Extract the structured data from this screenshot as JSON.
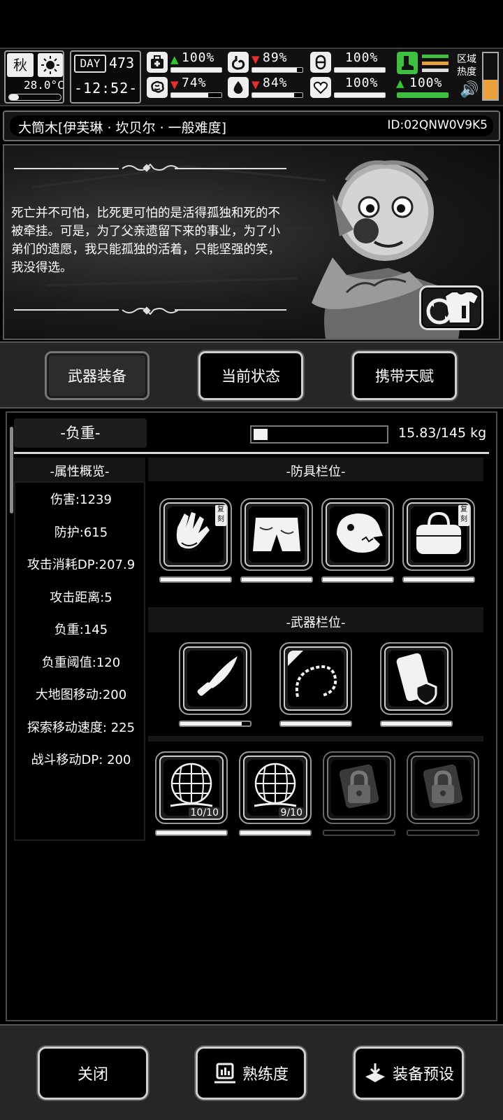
{
  "hud": {
    "season": "秋",
    "weather_icon": "sun-icon",
    "temperature": "28.0°C",
    "day_label": "DAY",
    "day_number": "473",
    "time": "-12:52-",
    "stats": [
      {
        "name": "health",
        "icon": "medkit-icon",
        "trend": "up",
        "value": "100%",
        "fill": 1.0
      },
      {
        "name": "hunger",
        "icon": "stomach-icon",
        "trend": "down",
        "value": "89%",
        "fill": 0.89
      },
      {
        "name": "stamina",
        "icon": "capsule-icon",
        "trend": "",
        "value": "100%",
        "fill": 1.0
      },
      {
        "name": "mental",
        "icon": "brain-icon",
        "trend": "down",
        "value": "74%",
        "fill": 0.74
      },
      {
        "name": "thirst",
        "icon": "water-drop-icon",
        "trend": "down",
        "value": "84%",
        "fill": 0.84
      },
      {
        "name": "mood",
        "icon": "heart-icon",
        "trend": "",
        "value": "100%",
        "fill": 1.0
      }
    ],
    "boot_value": "100%",
    "boot_trend": "up",
    "zone_label_1": "区域",
    "zone_label_2": "热度",
    "accent_green": "#3fbf3f",
    "accent_orange": "#e8a13c"
  },
  "title": {
    "name": "大筒木[伊芙琳 · 坎贝尔 · 一般难度]",
    "id": "ID:02QNW0V9K5"
  },
  "portrait": {
    "quote": "死亡并不可怕，比死更可怕的是活得孤独和死的不被牵挂。可是，为了父亲遗留下来的事业，为了小弟们的遗愿，我只能孤独的活着，只能坚强的笑，我没得选。",
    "swap_icon": "outfit-swap-icon"
  },
  "tabs": [
    {
      "label": "武器装备",
      "active": true
    },
    {
      "label": "当前状态",
      "active": false
    },
    {
      "label": "携带天赋",
      "active": false
    }
  ],
  "load": {
    "label": "-负重-",
    "text": "15.83/145 kg",
    "fill": 0.109
  },
  "attributes": {
    "title": "-属性概览-",
    "items": [
      "伤害:1239",
      "防护:615",
      "攻击消耗DP:207.9",
      "攻击距离:5",
      "负重:145",
      "负重阈值:120",
      "大地图移动:200",
      "探索移动速度: 225",
      "战斗移动DP: 200"
    ]
  },
  "armor": {
    "title": "-防具栏位-",
    "slots": [
      {
        "icon": "bone-gloves-icon",
        "badge": "复刻",
        "durability": 1.0
      },
      {
        "icon": "shorts-icon",
        "badge": "",
        "durability": 1.0
      },
      {
        "icon": "dinosaur-mask-icon",
        "badge": "",
        "durability": 1.0
      },
      {
        "icon": "duffel-bag-icon",
        "badge": "复刻",
        "durability": 1.0
      }
    ]
  },
  "weapons": {
    "title": "-武器栏位-",
    "slots": [
      {
        "icon": "knife-icon",
        "durability": 0.88
      },
      {
        "icon": "thorn-whip-icon",
        "durability": 1.0
      },
      {
        "icon": "riot-shield-icon",
        "durability": 1.0
      }
    ]
  },
  "tools": {
    "slots": [
      {
        "icon": "net-trap-icon",
        "count": "10/10",
        "durability": 1.0,
        "locked": false
      },
      {
        "icon": "net-trap-icon",
        "count": "9/10",
        "durability": 1.0,
        "locked": false
      },
      {
        "icon": "lock-icon",
        "count": "",
        "durability": 0,
        "locked": true
      },
      {
        "icon": "lock-icon",
        "count": "",
        "durability": 0,
        "locked": true
      }
    ]
  },
  "buttons": {
    "close": "关闭",
    "proficiency": "熟练度",
    "preset": "装备预设"
  }
}
